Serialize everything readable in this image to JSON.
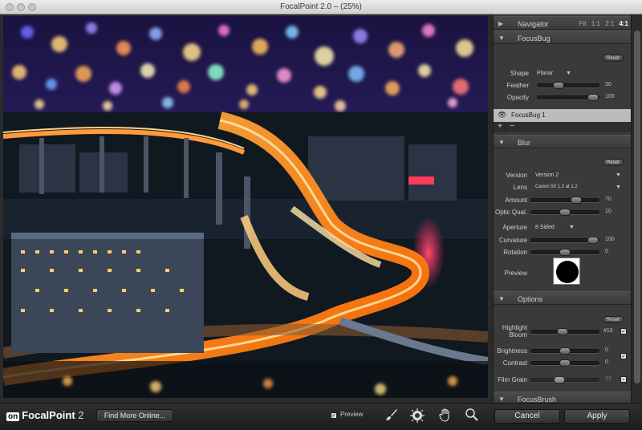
{
  "window": {
    "title": "FocalPoint 2.0 –  (25%)"
  },
  "navigator": {
    "label": "Navigator",
    "zoom_options": [
      "Fit",
      "1:1",
      "2:1",
      "4:1"
    ],
    "active_zoom": "4:1"
  },
  "focusbug": {
    "label": "FocusBug",
    "reset_label": "Reset",
    "shape_label": "Shape",
    "shape_value": "Planar",
    "feather_label": "Feather",
    "feather_value": "30",
    "feather_level": 0.3,
    "opacity_label": "Opacity",
    "opacity_value": "100",
    "opacity_level": 1.0,
    "item_name": "FocusBug 1",
    "add_label": "+",
    "remove_label": "−"
  },
  "blur": {
    "label": "Blur",
    "reset_label": "Reset",
    "version_label": "Version",
    "version_value": "Version 2",
    "lens_label": "Lens",
    "lens_value": "Canon 50 1.2 at 1.2",
    "amount_label": "Amount",
    "amount_value": "70",
    "amount_level": 0.7,
    "optic_label": "Optic Qual.",
    "optic_value": "10",
    "optic_level": 0.5,
    "aperture_label": "Aperture",
    "aperture_value": "8 Sided",
    "curvature_label": "Curvature",
    "curvature_value": "100",
    "curvature_level": 1.0,
    "rotation_label": "Rotation",
    "rotation_value": "0",
    "rotation_level": 0.5,
    "preview_label": "Preview"
  },
  "options": {
    "label": "Options",
    "reset_label": "Reset",
    "highlight_label": "Highlight",
    "bloom_label": "Bloom",
    "bloom_value": "#19",
    "bloom_level": 0.45,
    "brightness_label": "Brightness",
    "brightness_value": "0",
    "brightness_level": 0.5,
    "contrast_label": "Contrast",
    "contrast_value": "0",
    "contrast_level": 0.5,
    "film_grain_label": "Film Grain",
    "film_grain_value": "33",
    "film_grain_level": 0.4
  },
  "focusbrush": {
    "label": "FocusBrush"
  },
  "bottom": {
    "logo_on": "on",
    "logo_text": "FocalPoint",
    "logo_version": "2",
    "find_more": "Find More Online...",
    "preview_label": "Preview",
    "cancel": "Cancel",
    "apply": "Apply"
  },
  "colors": {
    "panel_bg": "#3a3a3a",
    "image_highway": "#ff8a1e",
    "image_sky": "#1a1240",
    "image_neon": "#ff2a6d"
  }
}
